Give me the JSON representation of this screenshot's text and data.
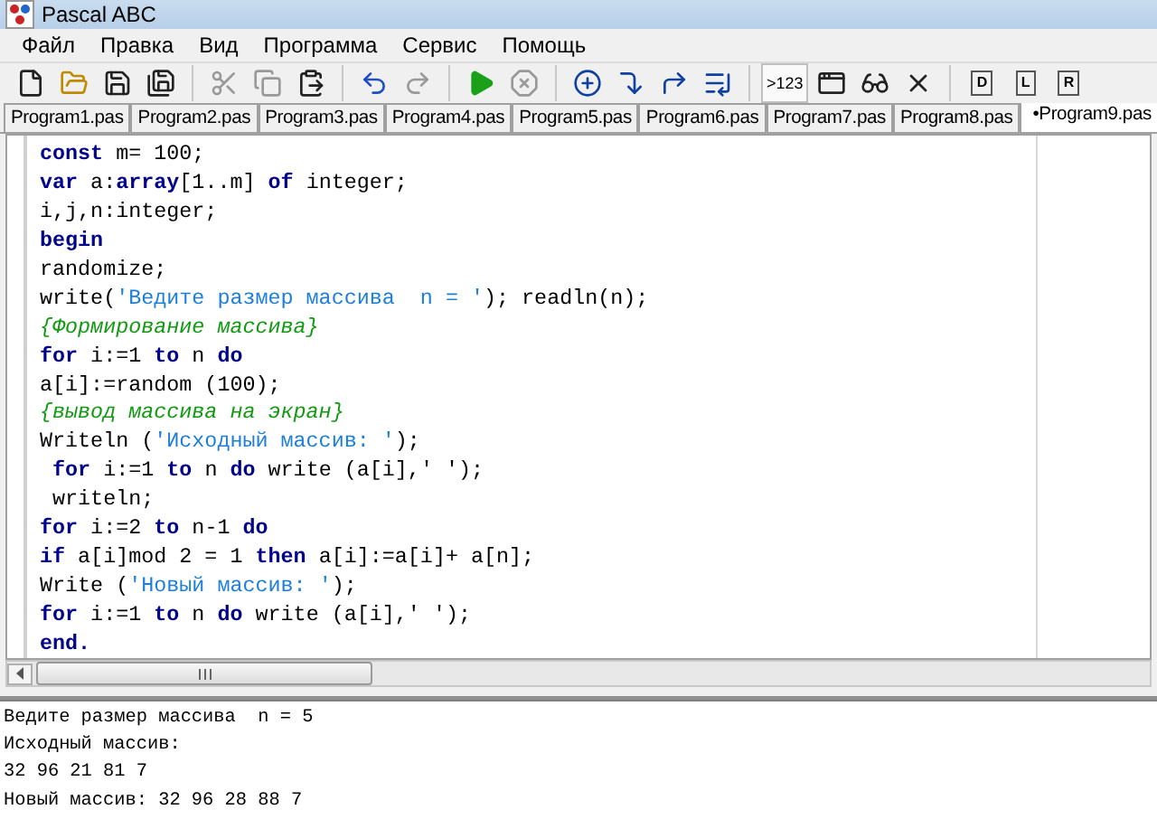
{
  "window": {
    "title": "Pascal ABC"
  },
  "menu": [
    "Файл",
    "Правка",
    "Вид",
    "Программа",
    "Сервис",
    "Помощь"
  ],
  "toolbar": [
    [
      {
        "kind": "new",
        "disabled": false
      },
      {
        "kind": "open",
        "disabled": false
      },
      {
        "kind": "save",
        "disabled": false
      },
      {
        "kind": "save-all",
        "disabled": false
      }
    ],
    [
      {
        "kind": "cut",
        "disabled": true
      },
      {
        "kind": "copy",
        "disabled": true
      },
      {
        "kind": "paste",
        "disabled": false
      }
    ],
    [
      {
        "kind": "undo",
        "disabled": false
      },
      {
        "kind": "redo",
        "disabled": true
      }
    ],
    [
      {
        "kind": "run",
        "disabled": false
      },
      {
        "kind": "stop",
        "disabled": true
      }
    ],
    [
      {
        "kind": "watch",
        "disabled": false
      },
      {
        "kind": "step-into",
        "disabled": false
      },
      {
        "kind": "step-over",
        "disabled": false
      },
      {
        "kind": "run-to",
        "disabled": false
      }
    ],
    [
      {
        "kind": "text",
        "label": ">123",
        "disabled": false,
        "selected": true
      },
      {
        "kind": "window",
        "disabled": false
      },
      {
        "kind": "glasses",
        "disabled": false
      },
      {
        "kind": "close",
        "disabled": false
      }
    ],
    [
      {
        "kind": "letter",
        "label": "D",
        "disabled": false
      },
      {
        "kind": "letter",
        "label": "L",
        "disabled": false
      },
      {
        "kind": "letter",
        "label": "R",
        "disabled": false
      }
    ]
  ],
  "tabs": [
    {
      "label": "Program1.pas",
      "selected": false
    },
    {
      "label": "Program2.pas",
      "selected": false
    },
    {
      "label": "Program3.pas",
      "selected": false
    },
    {
      "label": "Program4.pas",
      "selected": false
    },
    {
      "label": "Program5.pas",
      "selected": false
    },
    {
      "label": "Program6.pas",
      "selected": false
    },
    {
      "label": "Program7.pas",
      "selected": false
    },
    {
      "label": "Program8.pas",
      "selected": false
    },
    {
      "label": "•Program9.pas",
      "selected": true
    }
  ],
  "editor": {
    "lines": [
      [
        {
          "kind": "kw",
          "text": "const"
        },
        {
          "kind": "id",
          "text": " m= 100;"
        }
      ],
      [
        {
          "kind": "kw",
          "text": "var"
        },
        {
          "kind": "id",
          "text": " a:"
        },
        {
          "kind": "kw",
          "text": "array"
        },
        {
          "kind": "id",
          "text": "[1..m] "
        },
        {
          "kind": "kw",
          "text": "of"
        },
        {
          "kind": "id",
          "text": " integer;"
        }
      ],
      [
        {
          "kind": "id",
          "text": "i,j,n:integer;"
        }
      ],
      [
        {
          "kind": "kw",
          "text": "begin"
        }
      ],
      [
        {
          "kind": "id",
          "text": "randomize;"
        }
      ],
      [
        {
          "kind": "id",
          "text": "write("
        },
        {
          "kind": "str",
          "text": "'Ведите размер массива  n = '"
        },
        {
          "kind": "id",
          "text": "); readln(n);"
        }
      ],
      [
        {
          "kind": "cmt",
          "text": "{Формирование массива}"
        }
      ],
      [
        {
          "kind": "kw",
          "text": "for"
        },
        {
          "kind": "id",
          "text": " i:=1 "
        },
        {
          "kind": "kw",
          "text": "to"
        },
        {
          "kind": "id",
          "text": " n "
        },
        {
          "kind": "kw",
          "text": "do"
        }
      ],
      [
        {
          "kind": "id",
          "text": "a[i]:=random (100);"
        }
      ],
      [
        {
          "kind": "cmt",
          "text": "{вывод массива на экран}"
        }
      ],
      [
        {
          "kind": "id",
          "text": "Writeln ("
        },
        {
          "kind": "str",
          "text": "'Исходный массив: '"
        },
        {
          "kind": "id",
          "text": ");"
        }
      ],
      [
        {
          "kind": "kw",
          "text": " for"
        },
        {
          "kind": "id",
          "text": " i:=1 "
        },
        {
          "kind": "kw",
          "text": "to"
        },
        {
          "kind": "id",
          "text": " n "
        },
        {
          "kind": "kw",
          "text": "do"
        },
        {
          "kind": "id",
          "text": " write (a[i],' ');"
        }
      ],
      [
        {
          "kind": "id",
          "text": " writeln;"
        }
      ],
      [
        {
          "kind": "kw",
          "text": "for"
        },
        {
          "kind": "id",
          "text": " i:=2 "
        },
        {
          "kind": "kw",
          "text": "to"
        },
        {
          "kind": "id",
          "text": " n-1 "
        },
        {
          "kind": "kw",
          "text": "do"
        }
      ],
      [
        {
          "kind": "kw",
          "text": "if"
        },
        {
          "kind": "id",
          "text": " a[i]mod 2 = 1 "
        },
        {
          "kind": "kw",
          "text": "then"
        },
        {
          "kind": "id",
          "text": " a[i]:=a[i]+ a[n];"
        }
      ],
      [
        {
          "kind": "id",
          "text": "Write ("
        },
        {
          "kind": "str",
          "text": "'Новый массив: '"
        },
        {
          "kind": "id",
          "text": ");"
        }
      ],
      [
        {
          "kind": "kw",
          "text": "for"
        },
        {
          "kind": "id",
          "text": " i:=1 "
        },
        {
          "kind": "kw",
          "text": "to"
        },
        {
          "kind": "id",
          "text": " n "
        },
        {
          "kind": "kw",
          "text": "do"
        },
        {
          "kind": "id",
          "text": " write (a[i],' ');"
        }
      ],
      [
        {
          "kind": "kw",
          "text": "end."
        }
      ]
    ]
  },
  "output": [
    "Ведите размер массива  n = 5",
    "Исходный массив:",
    "32 96 21 81 7",
    "Новый массив: 32 96 28 88 7"
  ]
}
